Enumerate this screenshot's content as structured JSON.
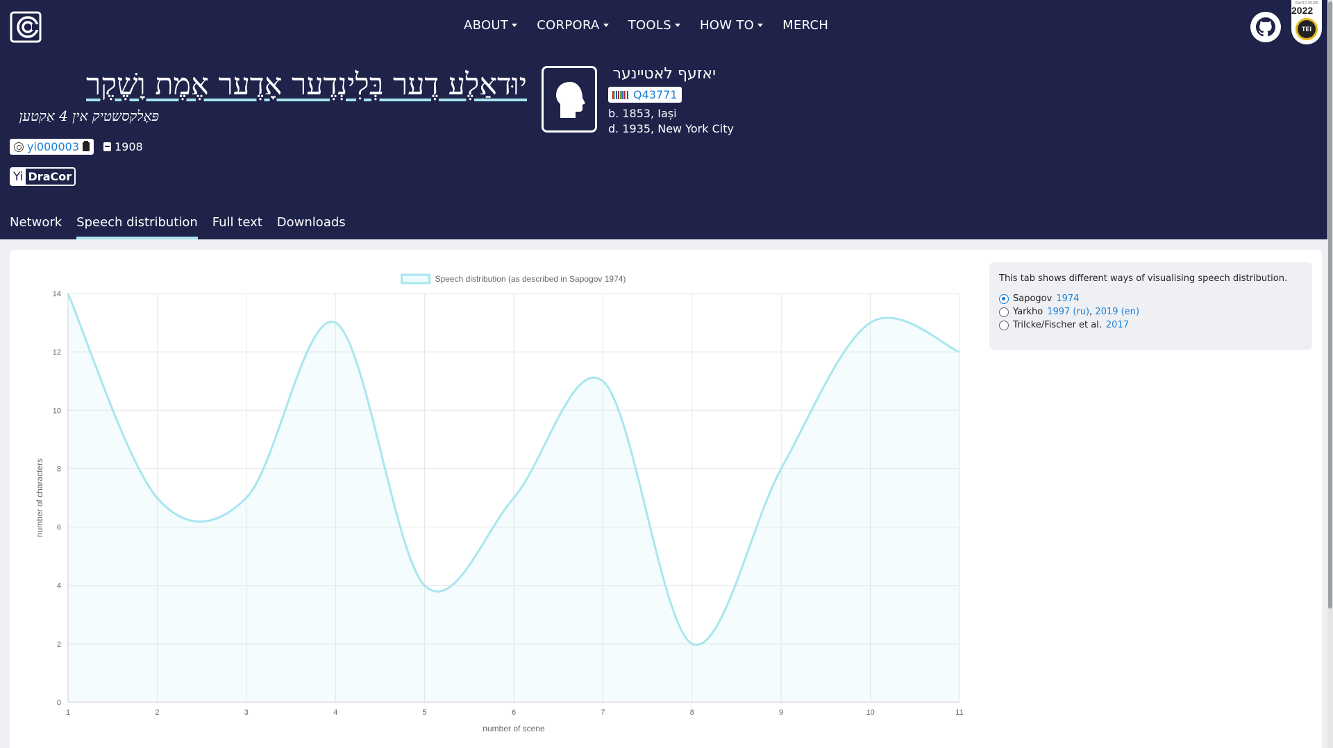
{
  "nav": {
    "items": [
      {
        "label": "ABOUT",
        "dropdown": true
      },
      {
        "label": "CORPORA",
        "dropdown": true
      },
      {
        "label": "TOOLS",
        "dropdown": true
      },
      {
        "label": "HOW TO",
        "dropdown": true
      },
      {
        "label": "MERCH",
        "dropdown": false
      }
    ]
  },
  "award": {
    "caption": "RAHTZ PRIZE",
    "year": "2022",
    "org": "TEI"
  },
  "play": {
    "title": "יוּדאַלֶע דֶער בְּלִינְדֶער אָדֶער אֶמֶת וָשֶׁקֶר",
    "subtitle": "פּאָלקסשטיק אין 4 אַקטען",
    "id": "yi000003",
    "year": "1908",
    "corpus_code": "Yi",
    "corpus_name": "DraCor"
  },
  "author": {
    "name": "יאזעף לאטיינער",
    "wikidata": "Q43771",
    "born": "b. 1853, Iași",
    "died": "d. 1935, New York City"
  },
  "tabs": [
    {
      "label": "Network",
      "active": false
    },
    {
      "label": "Speech distribution",
      "active": true
    },
    {
      "label": "Full text",
      "active": false
    },
    {
      "label": "Downloads",
      "active": false
    }
  ],
  "info": {
    "description": "This tab shows different ways of visualising speech distribution.",
    "opt1_name": "Sapogov",
    "opt1_link": "1974",
    "opt2_name": "Yarkho",
    "opt2_link_a": "1997 (ru)",
    "opt2_sep": ",",
    "opt2_link_b": "2019 (en)",
    "opt3_name": "Trilcke/Fischer et al.",
    "opt3_link": "2017",
    "selected": 1
  },
  "colors": {
    "header_bg": "#1f2249",
    "accent": "#a8e6ef",
    "link": "#1a7fd6"
  },
  "chart_data": {
    "type": "line",
    "smooth": true,
    "fill": true,
    "x": [
      1,
      2,
      3,
      4,
      5,
      6,
      7,
      8,
      9,
      10,
      11
    ],
    "series": [
      {
        "name": "Speech distribution (as described in Sapogov 1974)",
        "values": [
          14,
          7,
          7,
          13,
          4,
          7,
          11,
          2,
          8,
          13,
          12
        ]
      }
    ],
    "xlabel": "number of scene",
    "ylabel": "number of characters",
    "xlim": [
      1,
      11
    ],
    "ylim": [
      0,
      14
    ],
    "yticks": [
      0,
      2,
      4,
      6,
      8,
      10,
      12,
      14
    ],
    "grid": true,
    "legend": "top-center",
    "color": "#a8e6ef"
  }
}
